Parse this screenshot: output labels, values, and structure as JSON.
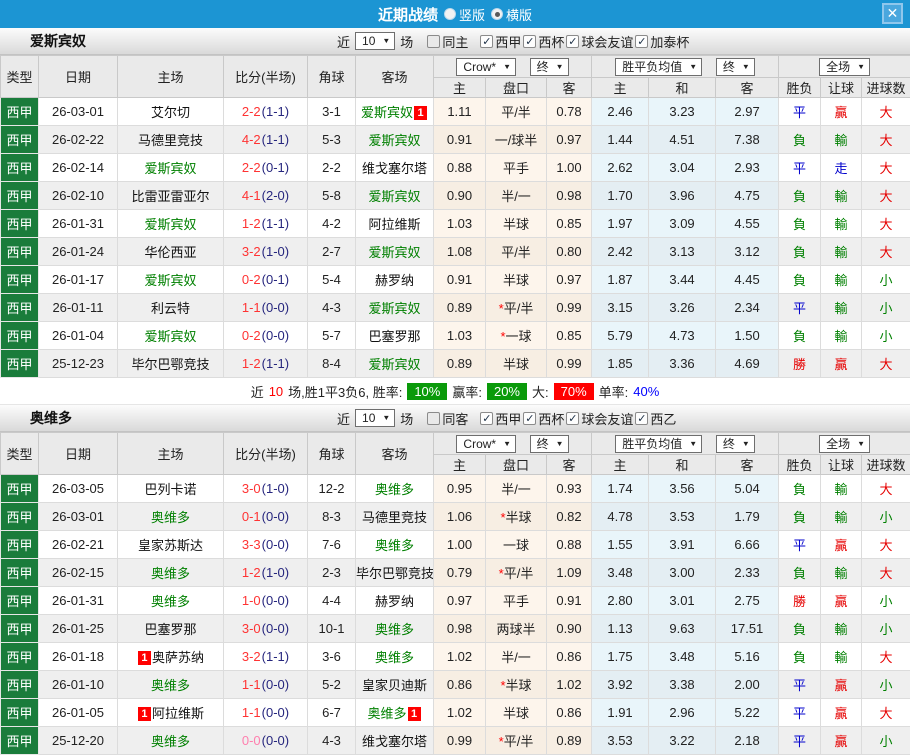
{
  "titlebar": {
    "title": "近期战绩",
    "close_glyph": "✕",
    "radios": [
      {
        "label": "竖版",
        "checked": false
      },
      {
        "label": "横版",
        "checked": true
      }
    ]
  },
  "columns": {
    "type": "类型",
    "date": "日期",
    "home": "主场",
    "score": "比分(半场)",
    "corner": "角球",
    "away": "客场",
    "odds_home": "主",
    "odds_handicap": "盘口",
    "odds_away": "客",
    "wdl_home": "主",
    "wdl_draw": "和",
    "wdl_away": "客",
    "result_wl": "胜负",
    "result_handicap": "让球",
    "result_goals": "进球数"
  },
  "dropdowns": {
    "company": "Crow*",
    "final": "终",
    "wdl_avg": "胜平负均值",
    "fulltime": "全场",
    "arrow": "▼"
  },
  "colors": {
    "topbar": "#1c95d3",
    "focal_team": "#008000",
    "score": "#ff3333",
    "score_light": "#ff7fae",
    "half_time": "#26267e",
    "league_cell_bg": "#1a7c3b",
    "result_colors": {
      "勝": "#e60000",
      "平": "#0000cc",
      "負": "#008000",
      "贏": "#e60000",
      "輸": "#008000",
      "走": "#0000cc",
      "大": "#e60000",
      "小": "#008000"
    },
    "rate_green_bg": "#0a9a0a",
    "rate_red_bg": "#ff0000",
    "single_rate": "#0000ff"
  },
  "tables": [
    {
      "team": "爱斯宾奴",
      "filters": {
        "near": "近",
        "count": "10",
        "unit": "场",
        "same": {
          "label": "同主",
          "checked": false
        },
        "leagues": [
          {
            "label": "西甲",
            "checked": true
          },
          {
            "label": "西杯",
            "checked": true
          },
          {
            "label": "球会友谊",
            "checked": true
          },
          {
            "label": "加泰杯",
            "checked": true
          }
        ]
      },
      "rows": [
        {
          "league": "西甲",
          "date": "26-03-01",
          "home": "艾尔切",
          "hf": false,
          "hb": "",
          "score": "2-2",
          "half": "(1-1)",
          "pink": false,
          "corner": "3-1",
          "away": "爱斯宾奴",
          "af": true,
          "ab": "1",
          "odds": [
            "1.11",
            "平/半",
            "0.78"
          ],
          "wdl": [
            "2.46",
            "3.23",
            "2.97"
          ],
          "res": [
            "平",
            "贏",
            "大"
          ]
        },
        {
          "league": "西甲",
          "date": "26-02-22",
          "home": "马德里竞技",
          "hf": false,
          "hb": "",
          "score": "4-2",
          "half": "(1-1)",
          "pink": false,
          "corner": "5-3",
          "away": "爱斯宾奴",
          "af": true,
          "ab": "",
          "odds": [
            "0.91",
            "一/球半",
            "0.97"
          ],
          "wdl": [
            "1.44",
            "4.51",
            "7.38"
          ],
          "res": [
            "負",
            "輸",
            "大"
          ]
        },
        {
          "league": "西甲",
          "date": "26-02-14",
          "home": "爱斯宾奴",
          "hf": true,
          "hb": "",
          "score": "2-2",
          "half": "(0-1)",
          "pink": false,
          "corner": "2-2",
          "away": "维戈塞尔塔",
          "af": false,
          "ab": "",
          "odds": [
            "0.88",
            "平手",
            "1.00"
          ],
          "wdl": [
            "2.62",
            "3.04",
            "2.93"
          ],
          "res": [
            "平",
            "走",
            "大"
          ]
        },
        {
          "league": "西甲",
          "date": "26-02-10",
          "home": "比雷亚雷亚尔",
          "hf": false,
          "hb": "",
          "score": "4-1",
          "half": "(2-0)",
          "pink": false,
          "corner": "5-8",
          "away": "爱斯宾奴",
          "af": true,
          "ab": "",
          "odds": [
            "0.90",
            "半/一",
            "0.98"
          ],
          "wdl": [
            "1.70",
            "3.96",
            "4.75"
          ],
          "res": [
            "負",
            "輸",
            "大"
          ]
        },
        {
          "league": "西甲",
          "date": "26-01-31",
          "home": "爱斯宾奴",
          "hf": true,
          "hb": "",
          "score": "1-2",
          "half": "(1-1)",
          "pink": false,
          "corner": "4-2",
          "away": "阿拉维斯",
          "af": false,
          "ab": "",
          "odds": [
            "1.03",
            "半球",
            "0.85"
          ],
          "wdl": [
            "1.97",
            "3.09",
            "4.55"
          ],
          "res": [
            "負",
            "輸",
            "大"
          ]
        },
        {
          "league": "西甲",
          "date": "26-01-24",
          "home": "华伦西亚",
          "hf": false,
          "hb": "",
          "score": "3-2",
          "half": "(1-0)",
          "pink": false,
          "corner": "2-7",
          "away": "爱斯宾奴",
          "af": true,
          "ab": "",
          "odds": [
            "1.08",
            "平/半",
            "0.80"
          ],
          "wdl": [
            "2.42",
            "3.13",
            "3.12"
          ],
          "res": [
            "負",
            "輸",
            "大"
          ]
        },
        {
          "league": "西甲",
          "date": "26-01-17",
          "home": "爱斯宾奴",
          "hf": true,
          "hb": "",
          "score": "0-2",
          "half": "(0-1)",
          "pink": false,
          "corner": "5-4",
          "away": "赫罗纳",
          "af": false,
          "ab": "",
          "odds": [
            "0.91",
            "半球",
            "0.97"
          ],
          "wdl": [
            "1.87",
            "3.44",
            "4.45"
          ],
          "res": [
            "負",
            "輸",
            "小"
          ]
        },
        {
          "league": "西甲",
          "date": "26-01-11",
          "home": "利云特",
          "hf": false,
          "hb": "",
          "score": "1-1",
          "half": "(0-0)",
          "pink": false,
          "corner": "4-3",
          "away": "爱斯宾奴",
          "af": true,
          "ab": "",
          "odds": [
            "0.89",
            "*平/半",
            "0.99"
          ],
          "wdl": [
            "3.15",
            "3.26",
            "2.34"
          ],
          "res": [
            "平",
            "輸",
            "小"
          ]
        },
        {
          "league": "西甲",
          "date": "26-01-04",
          "home": "爱斯宾奴",
          "hf": true,
          "hb": "",
          "score": "0-2",
          "half": "(0-0)",
          "pink": false,
          "corner": "5-7",
          "away": "巴塞罗那",
          "af": false,
          "ab": "",
          "odds": [
            "1.03",
            "*一球",
            "0.85"
          ],
          "wdl": [
            "5.79",
            "4.73",
            "1.50"
          ],
          "res": [
            "負",
            "輸",
            "小"
          ]
        },
        {
          "league": "西甲",
          "date": "25-12-23",
          "home": "毕尔巴鄂竞技",
          "hf": false,
          "hb": "",
          "score": "1-2",
          "half": "(1-1)",
          "pink": false,
          "corner": "8-4",
          "away": "爱斯宾奴",
          "af": true,
          "ab": "",
          "odds": [
            "0.89",
            "半球",
            "0.99"
          ],
          "wdl": [
            "1.85",
            "3.36",
            "4.69"
          ],
          "res": [
            "勝",
            "贏",
            "大"
          ]
        }
      ],
      "footer": {
        "near": "近",
        "count": "10",
        "text": "场,胜1平3负6, 胜率:",
        "win_rate": "10%",
        "odds_label": "赢率:",
        "odds_rate": "20%",
        "big_label": "大:",
        "big_rate": "70%",
        "single_label": "单率:",
        "single_rate": "40%"
      }
    },
    {
      "team": "奥维多",
      "filters": {
        "near": "近",
        "count": "10",
        "unit": "场",
        "same": {
          "label": "同客",
          "checked": false
        },
        "leagues": [
          {
            "label": "西甲",
            "checked": true
          },
          {
            "label": "西杯",
            "checked": true
          },
          {
            "label": "球会友谊",
            "checked": true
          },
          {
            "label": "西乙",
            "checked": true
          }
        ]
      },
      "rows": [
        {
          "league": "西甲",
          "date": "26-03-05",
          "home": "巴列卡诺",
          "hf": false,
          "hb": "",
          "score": "3-0",
          "half": "(1-0)",
          "pink": false,
          "corner": "12-2",
          "away": "奥维多",
          "af": true,
          "ab": "",
          "odds": [
            "0.95",
            "半/一",
            "0.93"
          ],
          "wdl": [
            "1.74",
            "3.56",
            "5.04"
          ],
          "res": [
            "負",
            "輸",
            "大"
          ]
        },
        {
          "league": "西甲",
          "date": "26-03-01",
          "home": "奥维多",
          "hf": true,
          "hb": "",
          "score": "0-1",
          "half": "(0-0)",
          "pink": false,
          "corner": "8-3",
          "away": "马德里竞技",
          "af": false,
          "ab": "",
          "odds": [
            "1.06",
            "*半球",
            "0.82"
          ],
          "wdl": [
            "4.78",
            "3.53",
            "1.79"
          ],
          "res": [
            "負",
            "輸",
            "小"
          ]
        },
        {
          "league": "西甲",
          "date": "26-02-21",
          "home": "皇家苏斯达",
          "hf": false,
          "hb": "",
          "score": "3-3",
          "half": "(0-0)",
          "pink": false,
          "corner": "7-6",
          "away": "奥维多",
          "af": true,
          "ab": "",
          "odds": [
            "1.00",
            "一球",
            "0.88"
          ],
          "wdl": [
            "1.55",
            "3.91",
            "6.66"
          ],
          "res": [
            "平",
            "贏",
            "大"
          ]
        },
        {
          "league": "西甲",
          "date": "26-02-15",
          "home": "奥维多",
          "hf": true,
          "hb": "",
          "score": "1-2",
          "half": "(1-0)",
          "pink": false,
          "corner": "2-3",
          "away": "毕尔巴鄂竞技",
          "af": false,
          "ab": "",
          "odds": [
            "0.79",
            "*平/半",
            "1.09"
          ],
          "wdl": [
            "3.48",
            "3.00",
            "2.33"
          ],
          "res": [
            "負",
            "輸",
            "大"
          ]
        },
        {
          "league": "西甲",
          "date": "26-01-31",
          "home": "奥维多",
          "hf": true,
          "hb": "",
          "score": "1-0",
          "half": "(0-0)",
          "pink": false,
          "corner": "4-4",
          "away": "赫罗纳",
          "af": false,
          "ab": "",
          "odds": [
            "0.97",
            "平手",
            "0.91"
          ],
          "wdl": [
            "2.80",
            "3.01",
            "2.75"
          ],
          "res": [
            "勝",
            "贏",
            "小"
          ]
        },
        {
          "league": "西甲",
          "date": "26-01-25",
          "home": "巴塞罗那",
          "hf": false,
          "hb": "",
          "score": "3-0",
          "half": "(0-0)",
          "pink": false,
          "corner": "10-1",
          "away": "奥维多",
          "af": true,
          "ab": "",
          "odds": [
            "0.98",
            "两球半",
            "0.90"
          ],
          "wdl": [
            "1.13",
            "9.63",
            "17.51"
          ],
          "res": [
            "負",
            "輸",
            "小"
          ]
        },
        {
          "league": "西甲",
          "date": "26-01-18",
          "home": "奥萨苏纳",
          "hf": false,
          "hb": "1",
          "score": "3-2",
          "half": "(1-1)",
          "pink": false,
          "corner": "3-6",
          "away": "奥维多",
          "af": true,
          "ab": "",
          "odds": [
            "1.02",
            "半/一",
            "0.86"
          ],
          "wdl": [
            "1.75",
            "3.48",
            "5.16"
          ],
          "res": [
            "負",
            "輸",
            "大"
          ]
        },
        {
          "league": "西甲",
          "date": "26-01-10",
          "home": "奥维多",
          "hf": true,
          "hb": "",
          "score": "1-1",
          "half": "(0-0)",
          "pink": false,
          "corner": "5-2",
          "away": "皇家贝迪斯",
          "af": false,
          "ab": "",
          "odds": [
            "0.86",
            "*半球",
            "1.02"
          ],
          "wdl": [
            "3.92",
            "3.38",
            "2.00"
          ],
          "res": [
            "平",
            "贏",
            "小"
          ]
        },
        {
          "league": "西甲",
          "date": "26-01-05",
          "home": "阿拉维斯",
          "hf": false,
          "hb": "1",
          "score": "1-1",
          "half": "(0-0)",
          "pink": false,
          "corner": "6-7",
          "away": "奥维多",
          "af": true,
          "ab": "1",
          "odds": [
            "1.02",
            "半球",
            "0.86"
          ],
          "wdl": [
            "1.91",
            "2.96",
            "5.22"
          ],
          "res": [
            "平",
            "贏",
            "大"
          ]
        },
        {
          "league": "西甲",
          "date": "25-12-20",
          "home": "奥维多",
          "hf": true,
          "hb": "",
          "score": "0-0",
          "half": "(0-0)",
          "pink": true,
          "corner": "4-3",
          "away": "维戈塞尔塔",
          "af": false,
          "ab": "",
          "odds": [
            "0.99",
            "*平/半",
            "0.89"
          ],
          "wdl": [
            "3.53",
            "3.22",
            "2.18"
          ],
          "res": [
            "平",
            "贏",
            "小"
          ]
        }
      ]
    }
  ]
}
